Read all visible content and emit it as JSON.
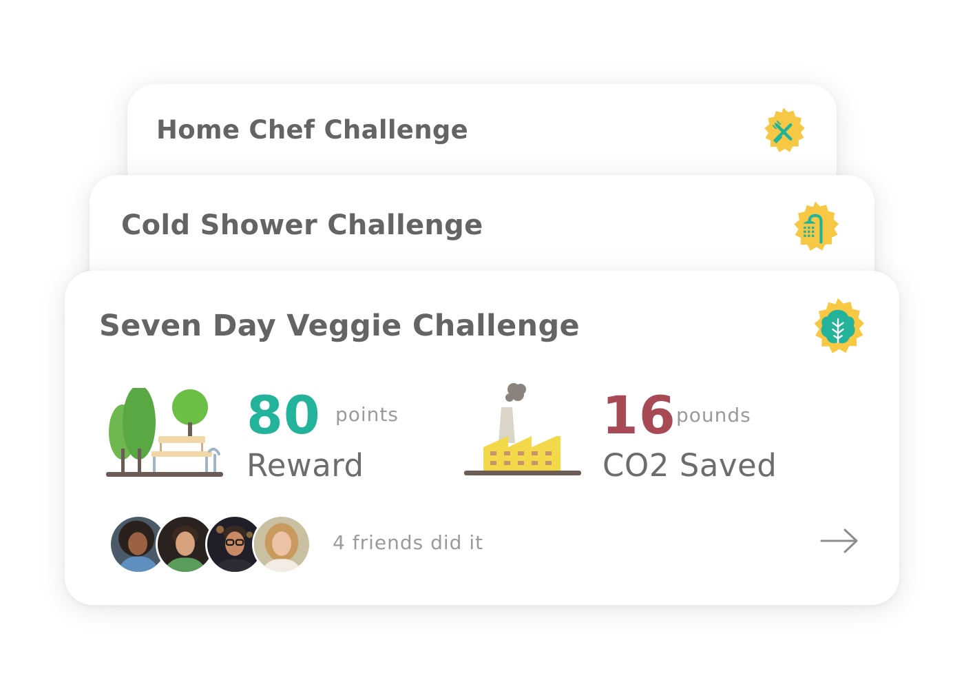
{
  "challenges": [
    {
      "title": "Home Chef Challenge",
      "badge_icon": "utensils-icon"
    },
    {
      "title": "Cold Shower Challenge",
      "badge_icon": "shower-icon"
    },
    {
      "title": "Seven Day Veggie Challenge",
      "badge_icon": "leaf-icon",
      "reward": {
        "value": "80",
        "unit": "points",
        "label": "Reward",
        "color": "#23b39a"
      },
      "co2": {
        "value": "16",
        "unit": "pounds",
        "label": "CO2 Saved",
        "color": "#a84a56"
      },
      "friends": {
        "count_text": "4 friends did it",
        "avatars": [
          "friend-avatar-1",
          "friend-avatar-2",
          "friend-avatar-3",
          "friend-avatar-4"
        ]
      }
    }
  ],
  "colors": {
    "badge_yellow": "#f6c843",
    "icon_teal": "#23b39a",
    "title_gray": "#646464"
  }
}
